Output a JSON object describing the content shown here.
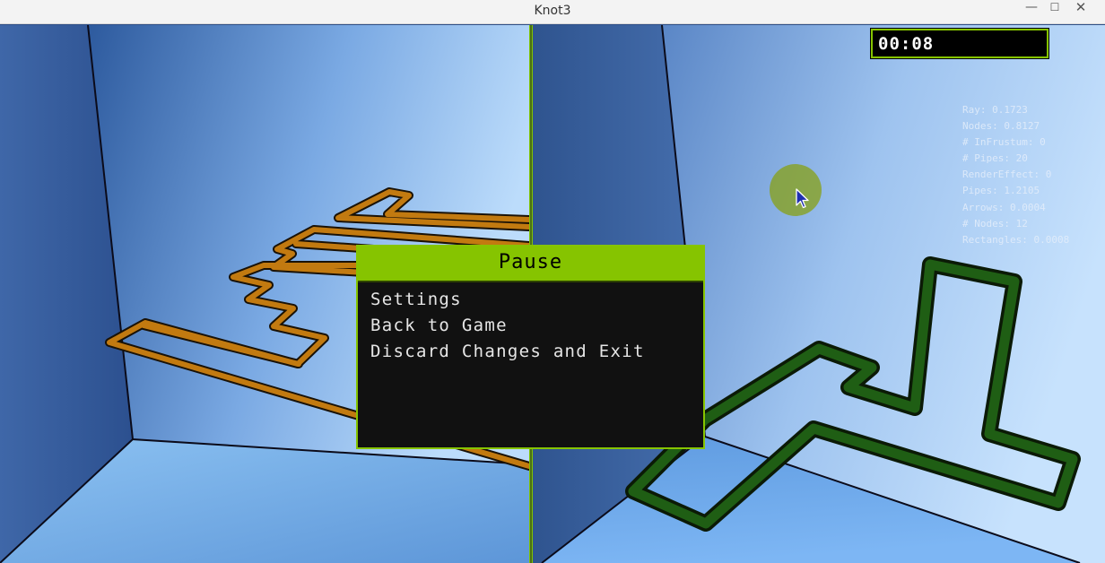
{
  "window": {
    "title": "Knot3",
    "minimize_glyph": "—",
    "maximize_glyph": "☐",
    "close_glyph": "✕"
  },
  "hud": {
    "timer": "00:08",
    "stats": [
      "Ray: 0.1723",
      "Nodes: 0.8127",
      "# InFrustum: 0",
      "# Pipes: 20",
      "RenderEffect: 0",
      "Pipes: 1.2105",
      "Arrows: 0.0004",
      "# Nodes: 12",
      "Rectangles: 0.0008"
    ]
  },
  "pause_menu": {
    "title": "Pause",
    "items": [
      "Settings",
      "Back to Game",
      "Discard Changes and Exit"
    ]
  },
  "scene": {
    "left_knot_color": "#c27a10",
    "right_knot_color": "#1f5e14",
    "accent_color": "#86c400"
  }
}
